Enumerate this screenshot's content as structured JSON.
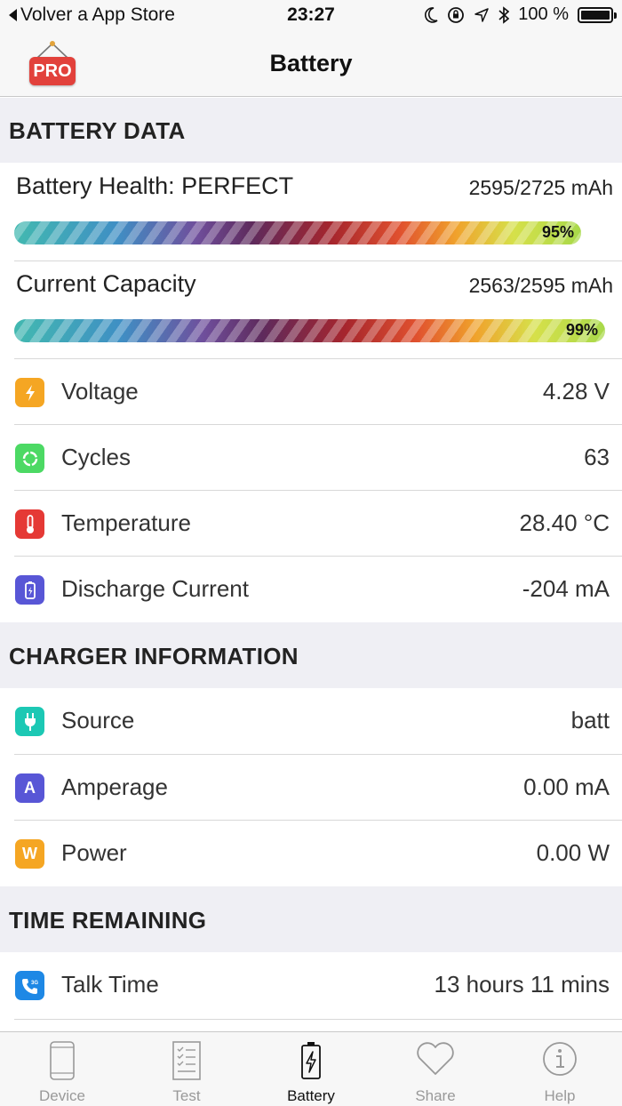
{
  "status_bar": {
    "back_label": "Volver a App Store",
    "time": "23:27",
    "battery_percent": "100 %"
  },
  "nav": {
    "title": "Battery",
    "pro_badge": "PRO"
  },
  "battery_data": {
    "header": "BATTERY DATA",
    "health": {
      "label": "Battery Health: PERFECT",
      "value": "2595/2725 mAh",
      "percent_label": "95%",
      "percent": 95
    },
    "capacity": {
      "label": "Current Capacity",
      "value": "2563/2595 mAh",
      "percent_label": "99%",
      "percent": 99
    },
    "rows": [
      {
        "label": "Voltage",
        "value": "4.28 V",
        "icon": "bolt-icon",
        "color": "#f5a623"
      },
      {
        "label": "Cycles",
        "value": "63",
        "icon": "cycle-icon",
        "color": "#4cd964"
      },
      {
        "label": "Temperature",
        "value": "28.40 °C",
        "icon": "thermometer-icon",
        "color": "#e53935"
      },
      {
        "label": "Discharge Current",
        "value": "-204 mA",
        "icon": "battery-icon",
        "color": "#5856d6"
      }
    ]
  },
  "charger": {
    "header": "CHARGER INFORMATION",
    "rows": [
      {
        "label": "Source",
        "value": "batt",
        "icon": "plug-icon",
        "color": "#1cc8b4"
      },
      {
        "label": "Amperage",
        "value": "0.00 mA",
        "icon": "a-letter-icon",
        "glyph": "A",
        "color": "#5856d6"
      },
      {
        "label": "Power",
        "value": "0.00 W",
        "icon": "w-letter-icon",
        "glyph": "W",
        "color": "#f5a623"
      }
    ]
  },
  "time_remaining": {
    "header": "TIME REMAINING",
    "rows": [
      {
        "label": "Talk Time",
        "value": "13 hours 11 mins",
        "icon": "phone-3g-icon",
        "glyph": "3G",
        "color": "#1e88e5"
      }
    ]
  },
  "tabs": [
    {
      "label": "Device",
      "icon": "phone-outline-icon",
      "active": false
    },
    {
      "label": "Test",
      "icon": "checklist-icon",
      "active": false
    },
    {
      "label": "Battery",
      "icon": "battery-bolt-icon",
      "active": true
    },
    {
      "label": "Share",
      "icon": "heart-icon",
      "active": false
    },
    {
      "label": "Help",
      "icon": "info-icon",
      "active": false
    }
  ]
}
